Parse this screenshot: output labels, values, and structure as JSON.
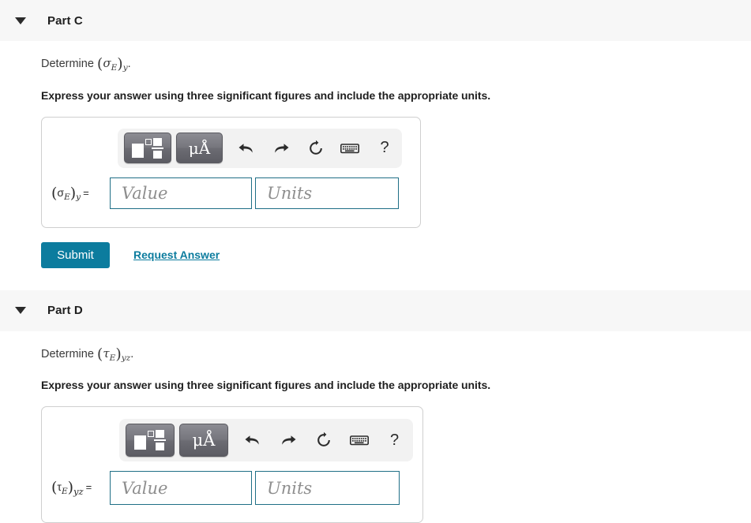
{
  "parts": [
    {
      "id": "part-c",
      "title": "Part C",
      "disclosure_icon": "triangle-down-icon",
      "determine_prefix": "Determine",
      "variable": {
        "open_paren": "(",
        "symbol": "σ",
        "symbol_sub": "E",
        "close_paren": ")",
        "outer_sub": "y",
        "trailing": "."
      },
      "instruction": "Express your answer using three significant figures and include the appropriate units.",
      "toolbar": {
        "template_button": "math-template-icon",
        "units_button": "μÅ",
        "undo_button": "undo-icon",
        "redo_button": "redo-icon",
        "reset_button": "reset-icon",
        "keyboard_button": "keyboard-icon",
        "help_button": "?"
      },
      "answer_label": {
        "open_paren": "(",
        "symbol": "σ",
        "symbol_sub": "E",
        "close_paren": ")",
        "outer_sub": "y",
        "equals": "="
      },
      "value_placeholder": "Value",
      "units_placeholder": "Units",
      "value_text": "",
      "units_text": "",
      "submit_label": "Submit",
      "request_answer_label": "Request Answer",
      "has_submit_row": true
    },
    {
      "id": "part-d",
      "title": "Part D",
      "disclosure_icon": "triangle-down-icon",
      "determine_prefix": "Determine",
      "variable": {
        "open_paren": "(",
        "symbol": "τ",
        "symbol_sub": "E",
        "close_paren": ")",
        "outer_sub": "yz",
        "trailing": "."
      },
      "instruction": "Express your answer using three significant figures and include the appropriate units.",
      "toolbar": {
        "template_button": "math-template-icon",
        "units_button": "μÅ",
        "undo_button": "undo-icon",
        "redo_button": "redo-icon",
        "reset_button": "reset-icon",
        "keyboard_button": "keyboard-icon",
        "help_button": "?"
      },
      "answer_label": {
        "open_paren": "(",
        "symbol": "τ",
        "symbol_sub": "E",
        "close_paren": ")",
        "outer_sub": "yz",
        "equals": "="
      },
      "value_placeholder": "Value",
      "units_placeholder": "Units",
      "value_text": "",
      "units_text": "",
      "has_submit_row": false
    }
  ],
  "colors": {
    "header_background": "#f7f7f7",
    "accent_teal": "#0c7c9e",
    "field_border": "#1f6f86",
    "box_border": "#cfcfcf",
    "toolbar_background": "#f2f2f2",
    "tool_button": "#6f6f76"
  }
}
